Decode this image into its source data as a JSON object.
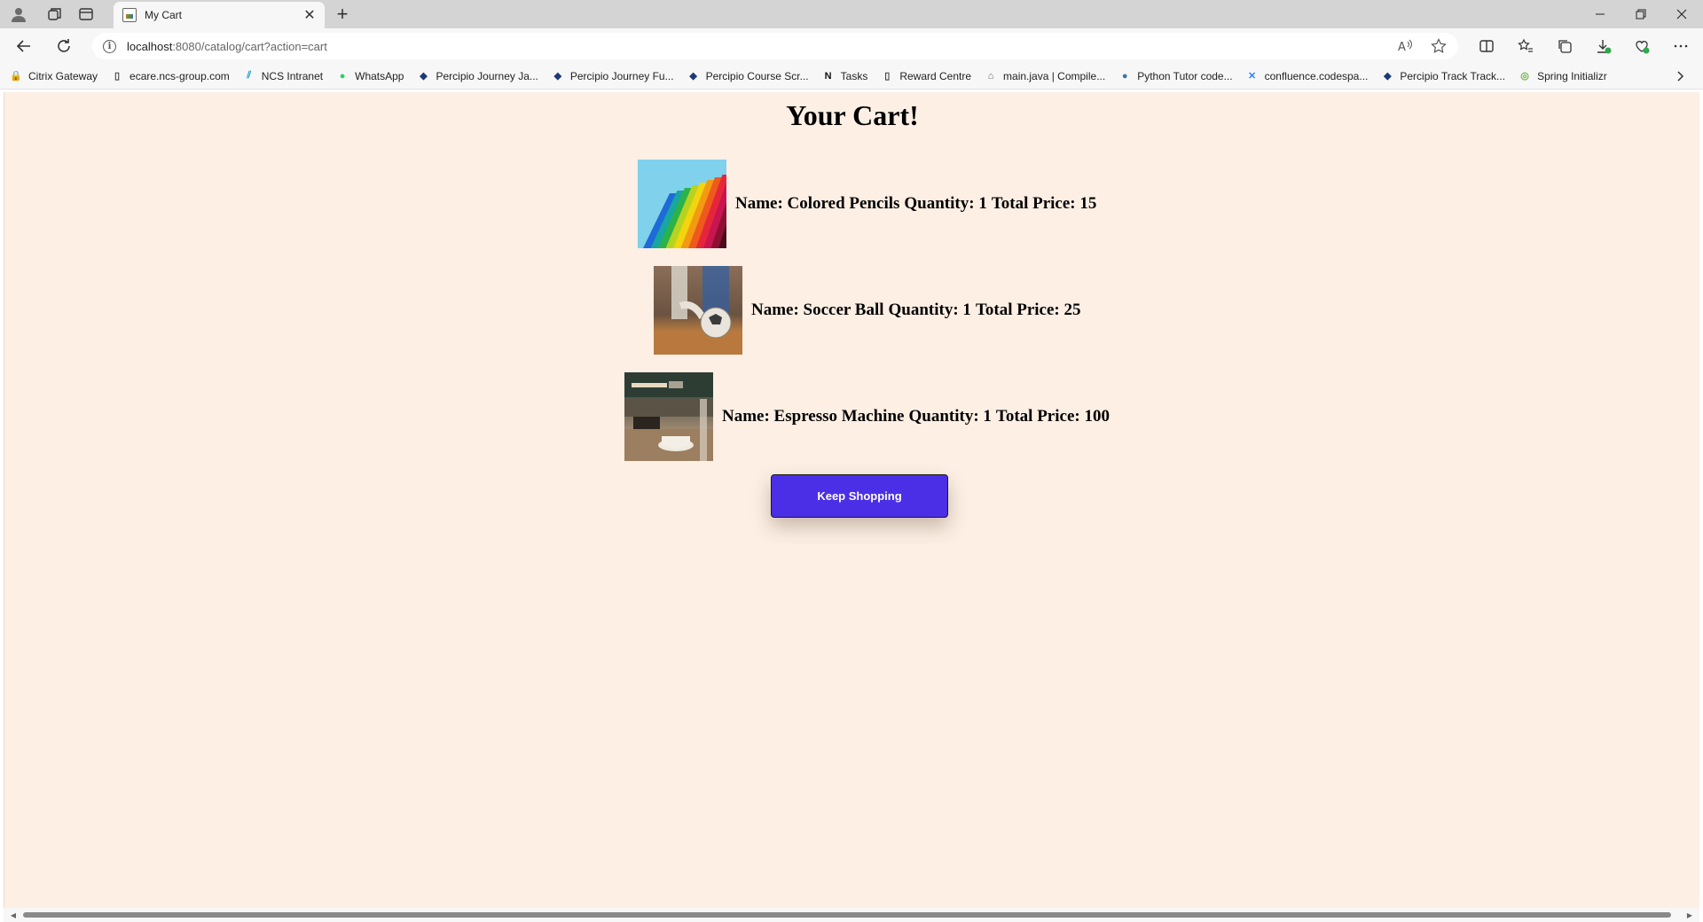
{
  "browser": {
    "tab": {
      "title": "My Cart"
    },
    "url": {
      "host": "localhost",
      "rest": ":8080/catalog/cart?action=cart"
    },
    "bookmarks": [
      {
        "label": "Citrix Gateway",
        "icon": "lock-icon",
        "color": "#2b4a8a"
      },
      {
        "label": "ecare.ncs-group.com",
        "icon": "page-icon",
        "color": "#444444"
      },
      {
        "label": "NCS Intranet",
        "icon": "ncs-icon",
        "color": "#1e9bd7"
      },
      {
        "label": "WhatsApp",
        "icon": "whatsapp-icon",
        "color": "#25d366"
      },
      {
        "label": "Percipio Journey Ja...",
        "icon": "percipio-icon",
        "color": "#1c3a78"
      },
      {
        "label": "Percipio Journey Fu...",
        "icon": "percipio-icon",
        "color": "#1c3a78"
      },
      {
        "label": "Percipio Course Scr...",
        "icon": "percipio-icon",
        "color": "#1c3a78"
      },
      {
        "label": "Tasks",
        "icon": "notion-icon",
        "color": "#111111"
      },
      {
        "label": "Reward Centre",
        "icon": "page-icon",
        "color": "#444444"
      },
      {
        "label": "main.java | Compile...",
        "icon": "compiler-icon",
        "color": "#666666"
      },
      {
        "label": "Python Tutor code...",
        "icon": "python-icon",
        "color": "#3776ab"
      },
      {
        "label": "confluence.codespa...",
        "icon": "confluence-icon",
        "color": "#2684ff"
      },
      {
        "label": "Percipio Track Track...",
        "icon": "percipio-icon",
        "color": "#1c3a78"
      },
      {
        "label": "Spring Initializr",
        "icon": "spring-icon",
        "color": "#6db33f"
      }
    ]
  },
  "page": {
    "title": "Your Cart!",
    "items": [
      {
        "name": "Name: Colored Pencils",
        "quantity": "Quantity: 1",
        "total": "Total Price: 15",
        "image": "colored-pencils-image"
      },
      {
        "name": "Name: Soccer Ball",
        "quantity": "Quantity: 1",
        "total": "Total Price: 25",
        "image": "soccer-ball-image"
      },
      {
        "name": "Name: Espresso Machine",
        "quantity": "Quantity: 1",
        "total": "Total Price: 100",
        "image": "espresso-machine-image"
      }
    ],
    "button": "Keep Shopping",
    "colors": {
      "background": "#fdefe4",
      "button": "#4b2fe6",
      "button_text": "#ffffff"
    }
  }
}
